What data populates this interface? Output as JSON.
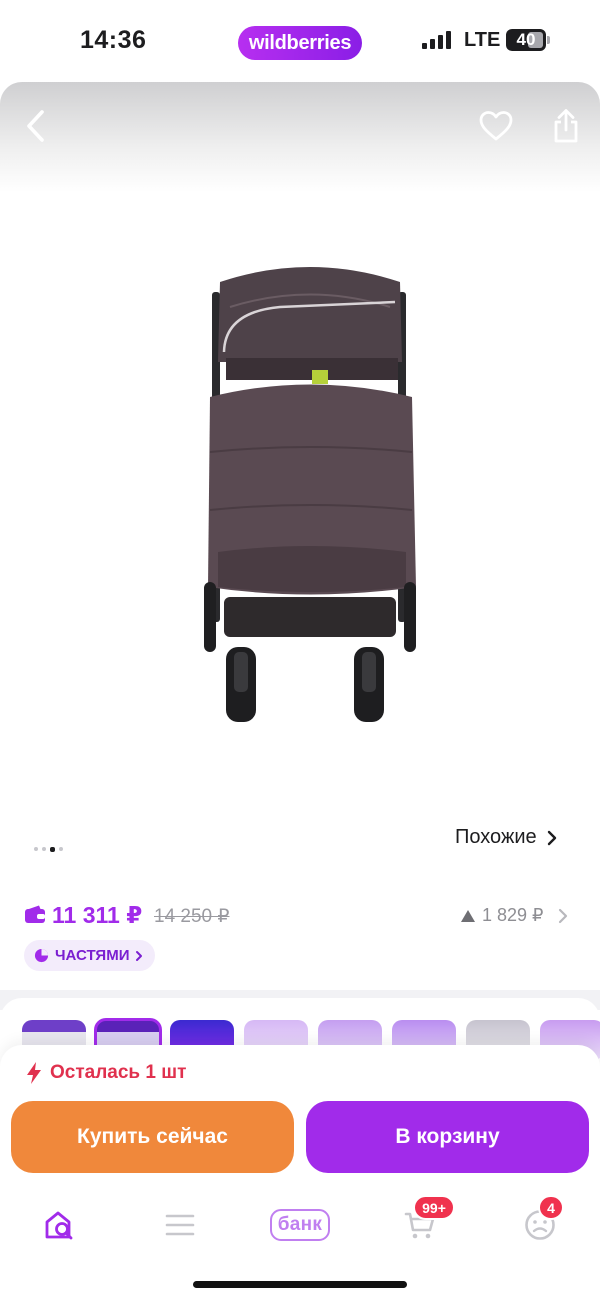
{
  "status_bar": {
    "time": "14:36",
    "network": "LTE",
    "battery": "40",
    "brand": "wildberries"
  },
  "header": {
    "back_icon": "chevron-left-icon",
    "favorite_icon": "heart-icon",
    "share_icon": "share-icon"
  },
  "gallery": {
    "slide_count": 4,
    "active_slide": 2,
    "similar_label": "Похожие"
  },
  "price": {
    "current": "11 311 ₽",
    "old": "14 250 ₽",
    "change": "1 829 ₽",
    "installments_label": "ЧАСТЯМИ",
    "accent_color": "#a12bea"
  },
  "stock": {
    "label": "Осталась 1 шт",
    "color": "#e0314e"
  },
  "actions": {
    "buy_now": "Купить сейчас",
    "to_cart": "В корзину",
    "buy_color": "#f0883b",
    "cart_color": "#a12bea"
  },
  "tab_bar": {
    "bank_label": "банк",
    "cart_badge": "99+",
    "profile_badge": "4",
    "items": [
      "home-search-icon",
      "catalog-menu-icon",
      "bank-icon",
      "cart-icon",
      "profile-icon"
    ]
  }
}
